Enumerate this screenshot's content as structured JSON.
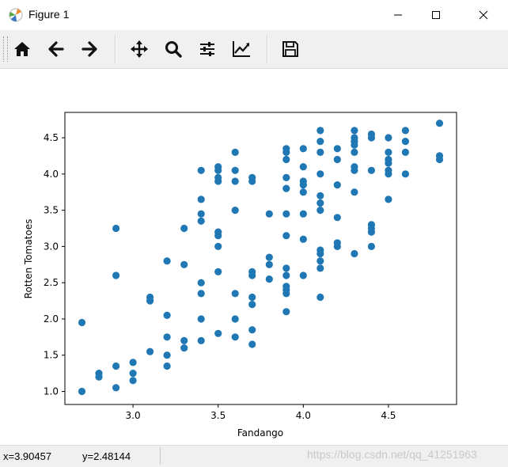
{
  "window": {
    "title": "Figure 1",
    "controls": [
      "minimize",
      "maximize",
      "close"
    ]
  },
  "toolbar": {
    "buttons": [
      {
        "name": "home",
        "icon": "home-icon"
      },
      {
        "name": "back",
        "icon": "arrow-left-icon"
      },
      {
        "name": "forward",
        "icon": "arrow-right-icon"
      },
      {
        "name": "pan",
        "icon": "move-icon"
      },
      {
        "name": "zoom",
        "icon": "magnifier-icon"
      },
      {
        "name": "subplots",
        "icon": "sliders-icon"
      },
      {
        "name": "customize",
        "icon": "line-chart-icon"
      },
      {
        "name": "save",
        "icon": "floppy-disk-icon"
      }
    ]
  },
  "status": {
    "x": "x=3.90457",
    "y": "y=2.48144",
    "watermark": "https://blog.csdn.net/qq_41251963"
  },
  "colors": {
    "marker": "#1f77b4",
    "titlebar": "#ffffff",
    "toolbar": "#f0f0f0"
  },
  "chart_data": {
    "type": "scatter",
    "xlabel": "Fandango",
    "ylabel": "Rotten Tomatoes",
    "xlim": [
      2.6,
      4.9
    ],
    "ylim": [
      0.82,
      4.85
    ],
    "xticks": [
      "3.0",
      "3.5",
      "4.0",
      "4.5"
    ],
    "yticks": [
      "1.0",
      "1.5",
      "2.0",
      "2.5",
      "3.0",
      "3.5",
      "4.0",
      "4.5"
    ],
    "points": [
      [
        2.7,
        1.95
      ],
      [
        2.7,
        1.0
      ],
      [
        2.8,
        1.25
      ],
      [
        2.8,
        1.2
      ],
      [
        2.9,
        3.25
      ],
      [
        2.9,
        2.6
      ],
      [
        2.9,
        1.35
      ],
      [
        2.9,
        1.05
      ],
      [
        3.0,
        1.4
      ],
      [
        3.0,
        1.25
      ],
      [
        3.0,
        1.15
      ],
      [
        3.1,
        2.3
      ],
      [
        3.1,
        2.25
      ],
      [
        3.1,
        1.55
      ],
      [
        3.2,
        2.8
      ],
      [
        3.2,
        2.05
      ],
      [
        3.2,
        1.75
      ],
      [
        3.2,
        1.5
      ],
      [
        3.2,
        1.35
      ],
      [
        3.3,
        3.25
      ],
      [
        3.3,
        2.75
      ],
      [
        3.3,
        1.7
      ],
      [
        3.3,
        1.6
      ],
      [
        3.4,
        4.05
      ],
      [
        3.4,
        3.65
      ],
      [
        3.4,
        3.45
      ],
      [
        3.4,
        3.35
      ],
      [
        3.4,
        2.5
      ],
      [
        3.4,
        2.35
      ],
      [
        3.4,
        2.0
      ],
      [
        3.4,
        1.7
      ],
      [
        3.5,
        4.1
      ],
      [
        3.5,
        4.05
      ],
      [
        3.5,
        3.95
      ],
      [
        3.5,
        3.9
      ],
      [
        3.5,
        3.2
      ],
      [
        3.5,
        3.15
      ],
      [
        3.5,
        3.0
      ],
      [
        3.5,
        2.65
      ],
      [
        3.5,
        1.8
      ],
      [
        3.6,
        4.3
      ],
      [
        3.6,
        4.05
      ],
      [
        3.6,
        3.9
      ],
      [
        3.6,
        3.5
      ],
      [
        3.6,
        2.35
      ],
      [
        3.6,
        2.0
      ],
      [
        3.6,
        1.75
      ],
      [
        3.7,
        3.95
      ],
      [
        3.7,
        3.9
      ],
      [
        3.7,
        2.65
      ],
      [
        3.7,
        2.6
      ],
      [
        3.7,
        2.3
      ],
      [
        3.7,
        2.2
      ],
      [
        3.7,
        1.85
      ],
      [
        3.7,
        1.65
      ],
      [
        3.8,
        3.45
      ],
      [
        3.8,
        2.85
      ],
      [
        3.8,
        2.75
      ],
      [
        3.8,
        2.55
      ],
      [
        3.9,
        4.35
      ],
      [
        3.9,
        4.3
      ],
      [
        3.9,
        4.2
      ],
      [
        3.9,
        3.95
      ],
      [
        3.9,
        3.8
      ],
      [
        3.9,
        3.45
      ],
      [
        3.9,
        3.15
      ],
      [
        3.9,
        2.7
      ],
      [
        3.9,
        2.6
      ],
      [
        3.9,
        2.45
      ],
      [
        3.9,
        2.4
      ],
      [
        3.9,
        2.35
      ],
      [
        3.9,
        2.1
      ],
      [
        4.0,
        4.35
      ],
      [
        4.0,
        4.1
      ],
      [
        4.0,
        3.9
      ],
      [
        4.0,
        3.85
      ],
      [
        4.0,
        3.75
      ],
      [
        4.0,
        3.45
      ],
      [
        4.0,
        3.1
      ],
      [
        4.0,
        2.6
      ],
      [
        4.1,
        4.6
      ],
      [
        4.1,
        4.45
      ],
      [
        4.1,
        4.3
      ],
      [
        4.1,
        4.0
      ],
      [
        4.1,
        3.7
      ],
      [
        4.1,
        3.6
      ],
      [
        4.1,
        3.5
      ],
      [
        4.1,
        2.95
      ],
      [
        4.1,
        2.9
      ],
      [
        4.1,
        2.8
      ],
      [
        4.1,
        2.7
      ],
      [
        4.1,
        2.3
      ],
      [
        4.2,
        4.35
      ],
      [
        4.2,
        4.2
      ],
      [
        4.2,
        3.85
      ],
      [
        4.2,
        3.4
      ],
      [
        4.2,
        3.05
      ],
      [
        4.2,
        3.0
      ],
      [
        4.3,
        4.6
      ],
      [
        4.3,
        4.5
      ],
      [
        4.3,
        4.45
      ],
      [
        4.3,
        4.4
      ],
      [
        4.3,
        4.3
      ],
      [
        4.3,
        4.1
      ],
      [
        4.3,
        4.05
      ],
      [
        4.3,
        3.75
      ],
      [
        4.3,
        2.9
      ],
      [
        4.4,
        4.55
      ],
      [
        4.4,
        4.5
      ],
      [
        4.4,
        4.05
      ],
      [
        4.4,
        3.3
      ],
      [
        4.4,
        3.25
      ],
      [
        4.4,
        3.2
      ],
      [
        4.4,
        3.0
      ],
      [
        4.5,
        4.5
      ],
      [
        4.5,
        4.3
      ],
      [
        4.5,
        4.2
      ],
      [
        4.5,
        4.15
      ],
      [
        4.5,
        4.05
      ],
      [
        4.5,
        4.0
      ],
      [
        4.5,
        3.65
      ],
      [
        4.6,
        4.6
      ],
      [
        4.6,
        4.45
      ],
      [
        4.6,
        4.3
      ],
      [
        4.6,
        4.0
      ],
      [
        4.8,
        4.7
      ],
      [
        4.8,
        4.25
      ],
      [
        4.8,
        4.2
      ]
    ]
  }
}
